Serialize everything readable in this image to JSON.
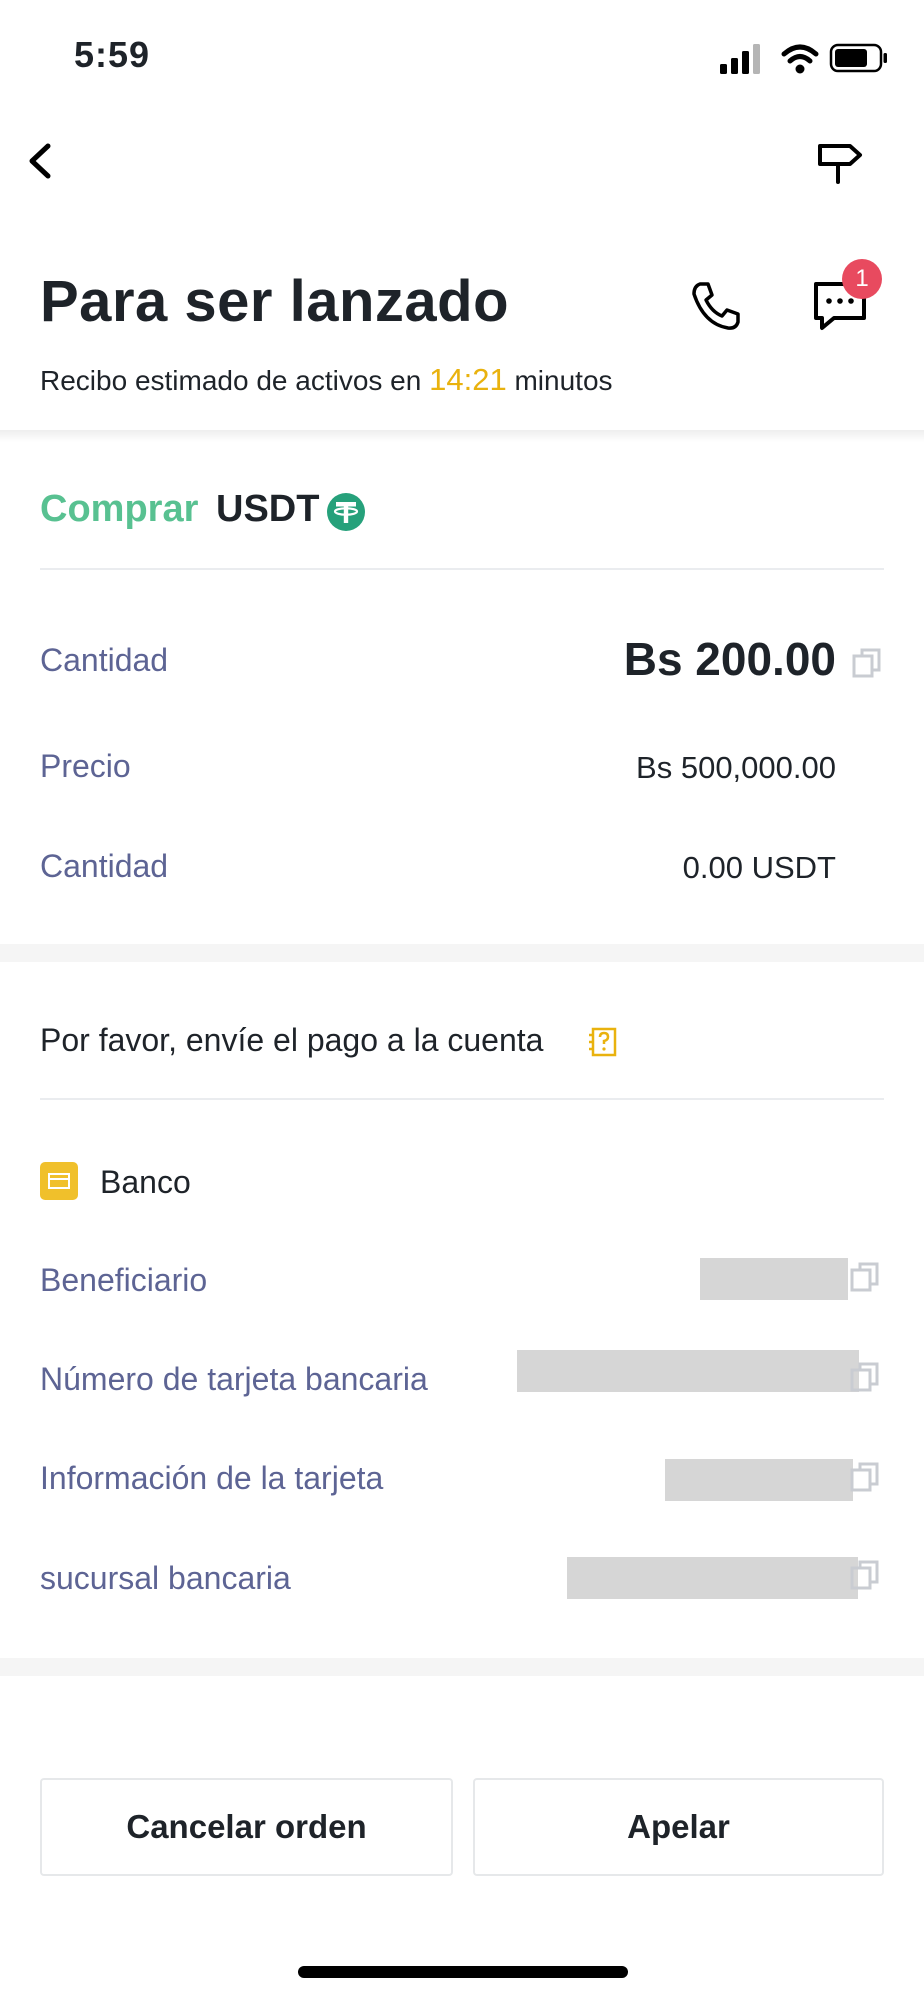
{
  "status_bar": {
    "time": "5:59"
  },
  "header": {
    "title": "Para ser lanzado",
    "subtitle_prefix": "Recibo estimado de activos en",
    "timer": "14:21",
    "subtitle_suffix": "minutos",
    "chat_badge": "1",
    "icons": [
      "back-icon",
      "signpost-icon",
      "phone-icon",
      "chat-icon"
    ]
  },
  "order": {
    "side": "Comprar",
    "asset": "USDT",
    "asset_icon": "tether-icon",
    "rows": [
      {
        "label": "Cantidad",
        "value": "Bs 200.00"
      },
      {
        "label": "Precio",
        "value": "Bs 500,000.00"
      },
      {
        "label": "Cantidad",
        "value": "0.00 USDT"
      }
    ]
  },
  "payment": {
    "title": "Por favor, envíe el pago a la cuenta",
    "method": "Banco",
    "fields": [
      {
        "label": "Beneficiario"
      },
      {
        "label": "Número de tarjeta bancaria"
      },
      {
        "label": "Información de la tarjeta"
      },
      {
        "label": "sucursal bancaria"
      }
    ]
  },
  "actions": {
    "cancel_label": "Cancelar orden",
    "appeal_label": "Apelar"
  },
  "colors": {
    "buy_green": "#58c191",
    "timer_yellow": "#e9b20e",
    "label_blue_gray": "#5d6494",
    "badge_red": "#e84a5f",
    "bank_icon_yellow": "#f0c02b"
  }
}
